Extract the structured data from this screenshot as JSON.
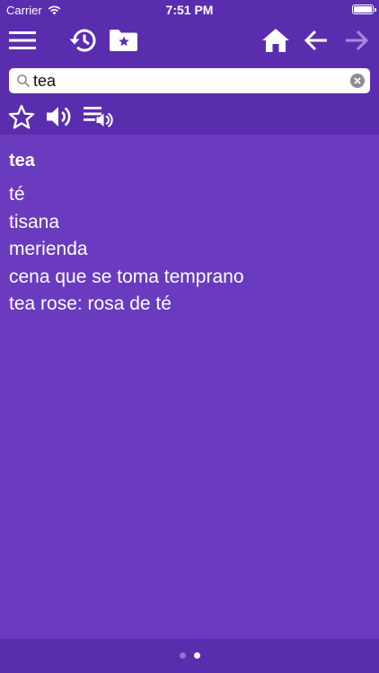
{
  "status": {
    "carrier": "Carrier",
    "time": "7:51 PM"
  },
  "toolbar": {
    "icons": [
      "menu-icon",
      "history-icon",
      "favorites-folder-icon",
      "home-icon",
      "back-arrow-icon",
      "forward-arrow-icon"
    ]
  },
  "search": {
    "value": "tea",
    "placeholder": ""
  },
  "actions": {
    "icons": [
      "star-icon",
      "speaker-icon",
      "playlist-audio-icon"
    ]
  },
  "entry": {
    "word": "tea",
    "definitions": [
      "té",
      "tisana",
      "merienda",
      "cena que se toma temprano",
      "tea rose: rosa de té"
    ]
  },
  "pager": {
    "pages": 2,
    "active": 2
  },
  "colors": {
    "header": "#5a2daf",
    "content": "#6a3bbf",
    "disabled_icon": "#a78be0"
  }
}
